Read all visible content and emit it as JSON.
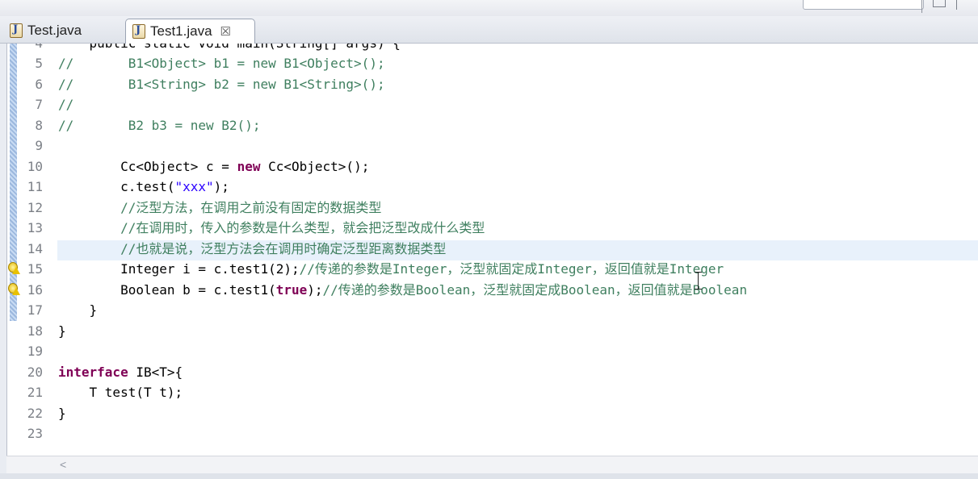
{
  "tabs": [
    {
      "label": "Test.java",
      "active": false
    },
    {
      "label": "Test1.java",
      "active": true,
      "close_glyph": "☒"
    }
  ],
  "editor": {
    "top_partial_line": "    public static void main(String[] args) {",
    "lines": [
      {
        "num": "5",
        "parts": [
          {
            "t": "//       B1<Object> b1 = new B1<Object>();",
            "c": "cm"
          }
        ]
      },
      {
        "num": "6",
        "parts": [
          {
            "t": "//       B1<String> b2 = new B1<String>();",
            "c": "cm"
          }
        ]
      },
      {
        "num": "7",
        "parts": [
          {
            "t": "//",
            "c": "cm"
          }
        ]
      },
      {
        "num": "8",
        "parts": [
          {
            "t": "//       B2 b3 = new B2();",
            "c": "cm"
          }
        ]
      },
      {
        "num": "9",
        "parts": []
      },
      {
        "num": "10",
        "parts": [
          {
            "t": "        Cc<Object> c = ",
            "c": ""
          },
          {
            "t": "new",
            "c": "kw"
          },
          {
            "t": " Cc<Object>();",
            "c": ""
          }
        ]
      },
      {
        "num": "11",
        "parts": [
          {
            "t": "        c.test(",
            "c": ""
          },
          {
            "t": "\"xxx\"",
            "c": "str"
          },
          {
            "t": ");",
            "c": ""
          }
        ]
      },
      {
        "num": "12",
        "parts": [
          {
            "t": "        //泛型方法，在调用之前没有固定的数据类型",
            "c": "cm"
          }
        ]
      },
      {
        "num": "13",
        "parts": [
          {
            "t": "        //在调用时，传入的参数是什么类型，就会把泛型改成什么类型",
            "c": "cm"
          }
        ]
      },
      {
        "num": "14",
        "parts": [
          {
            "t": "        //也就是说，泛型方法会在调用时确定泛型距离数据类型",
            "c": "cm"
          }
        ],
        "highlight": true
      },
      {
        "num": "15",
        "parts": [
          {
            "t": "        Integer i = c.test1(2);",
            "c": ""
          },
          {
            "t": "//传递的参数是Integer，泛型就固定成Integer，返回值就是Integer",
            "c": "cm"
          }
        ],
        "warning": true
      },
      {
        "num": "16",
        "parts": [
          {
            "t": "        Boolean b = c.test1(",
            "c": ""
          },
          {
            "t": "true",
            "c": "kw"
          },
          {
            "t": ");",
            "c": ""
          },
          {
            "t": "//传递的参数是Boolean，泛型就固定成Boolean，返回值就是Boolean",
            "c": "cm"
          }
        ],
        "warning": true
      },
      {
        "num": "17",
        "parts": [
          {
            "t": "    }",
            "c": ""
          }
        ]
      },
      {
        "num": "18",
        "parts": [
          {
            "t": "}",
            "c": ""
          }
        ]
      },
      {
        "num": "19",
        "parts": []
      },
      {
        "num": "20",
        "parts": [
          {
            "t": "interface",
            "c": "kw"
          },
          {
            "t": " IB<T>{",
            "c": ""
          }
        ]
      },
      {
        "num": "21",
        "parts": [
          {
            "t": "    T test(T t);",
            "c": ""
          }
        ]
      },
      {
        "num": "22",
        "parts": [
          {
            "t": "}",
            "c": ""
          }
        ]
      },
      {
        "num": "23",
        "parts": []
      }
    ]
  },
  "scrollbar": {
    "left_arrow": "<"
  }
}
